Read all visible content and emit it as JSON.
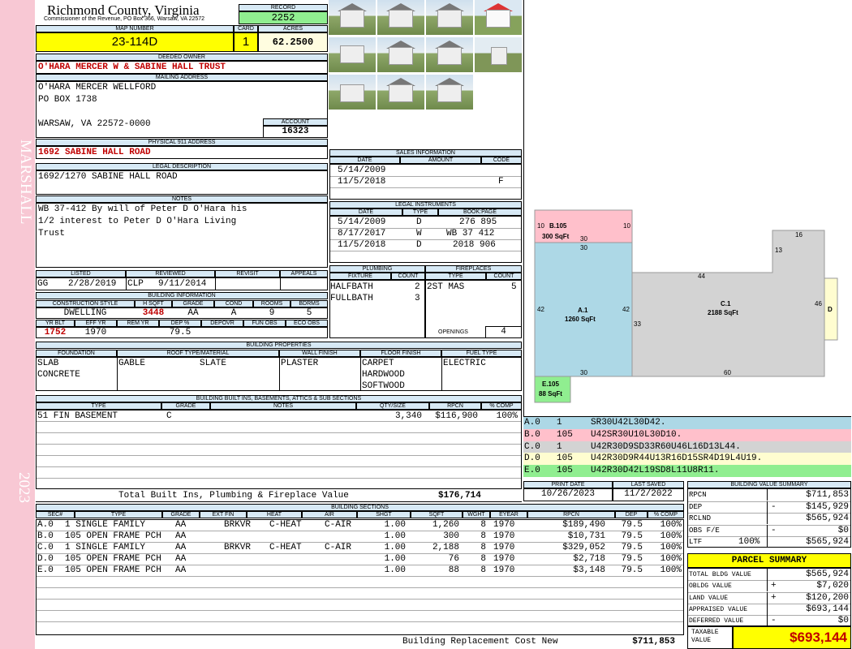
{
  "side_label": "MARSHALL",
  "side_year": "2023",
  "header": {
    "county": "Richmond County, Virginia",
    "subtitle": "Commissioner of the Revenue, PO Box 366, Warsaw, VA 22572",
    "record_label": "RECORD",
    "record": "2252"
  },
  "map_number_label": "MAP NUMBER",
  "map_number": "23-114D",
  "card_label": "CARD",
  "card": "1",
  "acres_label": "ACRES",
  "acres": "62.2500",
  "owner_label": "DEEDED OWNER",
  "owner": "O'HARA MERCER W & SABINE HALL TRUST",
  "mailing_label": "MAILING ADDRESS",
  "mailing": [
    "O'HARA MERCER WELLFORD",
    "PO BOX 1738",
    "",
    "WARSAW, VA 22572-0000"
  ],
  "account_label": "ACCOUNT",
  "account": "16323",
  "physical_label": "PHYSICAL 911 ADDRESS",
  "physical": "1692 SABINE HALL ROAD",
  "legal_label": "LEGAL DESCRIPTION",
  "legal": "1692/1270 SABINE HALL ROAD",
  "notes_label": "NOTES",
  "notes": [
    "WB 37-412 By will of Peter D O'Hara his",
    "1/2 interest to Peter D O'Hara Living",
    "Trust"
  ],
  "listed": {
    "labels": [
      "LISTED",
      "REVIEWED",
      "REVISIT",
      "APPEALS"
    ],
    "listed_by": "GG",
    "listed_date": "2/28/2019",
    "reviewed_by": "CLP",
    "reviewed_date": "9/11/2014"
  },
  "bldg_info": {
    "title": "BUILDING INFORMATION",
    "h1": [
      "CONSTRUCTION STYLE",
      "H SQFT",
      "GRADE",
      "COND",
      "ROOMS",
      "BDRMS"
    ],
    "v1": [
      "DWELLING",
      "3448",
      "AA",
      "A",
      "9",
      "5"
    ],
    "h2": [
      "YR BLT",
      "EFF YR",
      "REM YR",
      "DEP %",
      "DEPOVR",
      "FUN OBS",
      "ECO OBS"
    ],
    "v2": [
      "1752",
      "1970",
      "",
      "79.5",
      "",
      "",
      ""
    ]
  },
  "sales": {
    "title": "SALES INFORMATION",
    "cols": [
      "DATE",
      "AMOUNT",
      "CODE"
    ],
    "rows": [
      [
        "5/14/2009",
        "",
        ""
      ],
      [
        "11/5/2018",
        "",
        "F"
      ]
    ]
  },
  "legal_inst": {
    "title": "LEGAL INSTRUMENTS",
    "cols": [
      "DATE",
      "TYPE",
      "BOOK:PAGE"
    ],
    "rows": [
      [
        "5/14/2009",
        "D",
        "276 895"
      ],
      [
        "8/17/2017",
        "W",
        "WB 37 412"
      ],
      [
        "11/5/2018",
        "D",
        "2018 906"
      ]
    ]
  },
  "plumbing": {
    "title": "PLUMBING",
    "cols": [
      "FIXTURE",
      "COUNT"
    ],
    "rows": [
      [
        "HALFBATH",
        "2"
      ],
      [
        "FULLBATH",
        "3"
      ]
    ]
  },
  "fireplaces": {
    "title": "FIREPLACES",
    "cols": [
      "TYPE",
      "COUNT"
    ],
    "rows": [
      [
        "2ST MAS",
        "5"
      ]
    ],
    "openings_label": "OPENINGS",
    "openings": "4"
  },
  "props": {
    "title": "BUILDING PROPERTIES",
    "cols": [
      "FOUNDATION",
      "ROOF TYPE/MATERIAL",
      "WALL FINISH",
      "FLOOR FINISH",
      "FUEL TYPE"
    ],
    "foundation": [
      "SLAB",
      "CONCRETE"
    ],
    "roof_type": "GABLE",
    "roof_mat": "SLATE",
    "wall": "PLASTER",
    "floor": [
      "CARPET",
      "HARDWOOD",
      "SOFTWOOD"
    ],
    "fuel": "ELECTRIC"
  },
  "builtins": {
    "title": "BUILDING BUILT INS, BASEMENTS, ATTICS & SUB SECTIONS",
    "cols": [
      "TYPE",
      "GRADE",
      "NOTES",
      "QTY/SIZE",
      "RPCN",
      "% COMP"
    ],
    "row": [
      "51 FIN BASEMENT",
      "C",
      "",
      "3,340",
      "$116,900",
      "100%"
    ],
    "total_label": "Total Built Ins, Plumbing & Fireplace Value",
    "total": "$176,714"
  },
  "sketch": {
    "labels": {
      "a": "A.1",
      "a_sq": "1260 SqFt",
      "b": "B.105",
      "b_sq": "300 SqFt",
      "c": "C.1",
      "c_sq": "2188 SqFt",
      "d": "D",
      "e": "E.105",
      "e_sq": "88 SqFt"
    },
    "dims": [
      "10",
      "30",
      "10",
      "30",
      "42",
      "42",
      "30",
      "33",
      "44",
      "13",
      "16",
      "46",
      "60"
    ]
  },
  "vectors": [
    {
      "id": "A.0",
      "n": "1",
      "v": "SR30U42L30D42.",
      "color": "#add8e6"
    },
    {
      "id": "B.0",
      "n": "105",
      "v": "U42SR30U10L30D10.",
      "color": "#ffc0cb"
    },
    {
      "id": "C.0",
      "n": "1",
      "v": "U42R30D9SD33R60U46L16D13L44.",
      "color": "#d3d3d3"
    },
    {
      "id": "D.0",
      "n": "105",
      "v": "U42R30D9R44U13R16D15SR4D19L4U19.",
      "color": "#fffdd0"
    },
    {
      "id": "E.0",
      "n": "105",
      "v": "U42R30D42L19SD8L11U8R11.",
      "color": "#90ee90"
    }
  ],
  "print": {
    "print_label": "PRINT DATE",
    "print_date": "10/26/2023",
    "saved_label": "LAST SAVED",
    "saved_date": "11/2/2022"
  },
  "bvs": {
    "title": "BUILDING VALUE SUMMARY",
    "rows": [
      [
        "RPCN",
        "",
        "",
        "$711,853"
      ],
      [
        "DEP",
        "",
        "-",
        "$145,929"
      ],
      [
        "RCLND",
        "",
        "",
        "$565,924"
      ],
      [
        "OBS F/E",
        "",
        "-",
        "$0"
      ],
      [
        "LTF",
        "100%",
        "",
        "$565,924"
      ]
    ]
  },
  "parcel": {
    "title": "PARCEL SUMMARY",
    "rows": [
      [
        "TOTAL BLDG VALUE",
        "",
        "$565,924"
      ],
      [
        "OBLDG VALUE",
        "+",
        "$7,020"
      ],
      [
        "LAND VALUE",
        "+",
        "$120,200"
      ],
      [
        "APPRAISED VALUE",
        "",
        "$693,144"
      ],
      [
        "DEFERRED VALUE",
        "-",
        "$0"
      ]
    ],
    "taxable_label": "TAXABLE VALUE",
    "taxable": "$693,144"
  },
  "sections": {
    "title": "BUILDING SECTIONS",
    "cols": [
      "SEC#",
      "TYPE",
      "GRADE",
      "EXT FIN",
      "HEAT",
      "AIR",
      "SHGT",
      "SQFT",
      "WGHT",
      "EYEAR",
      "RPCN",
      "DEP",
      "% COMP"
    ],
    "rows": [
      [
        "A.0",
        "1 SINGLE FAMILY",
        "AA",
        "BRKVR",
        "C-HEAT",
        "C-AIR",
        "1.00",
        "1,260",
        "8",
        "1970",
        "$189,490",
        "79.5",
        "100%"
      ],
      [
        "B.0",
        "105 OPEN FRAME PCH",
        "AA",
        "",
        "",
        "",
        "1.00",
        "300",
        "8",
        "1970",
        "$10,731",
        "79.5",
        "100%"
      ],
      [
        "C.0",
        "1 SINGLE FAMILY",
        "AA",
        "BRKVR",
        "C-HEAT",
        "C-AIR",
        "1.00",
        "2,188",
        "8",
        "1970",
        "$329,052",
        "79.5",
        "100%"
      ],
      [
        "D.0",
        "105 OPEN FRAME PCH",
        "AA",
        "",
        "",
        "",
        "1.00",
        "76",
        "8",
        "1970",
        "$2,718",
        "79.5",
        "100%"
      ],
      [
        "E.0",
        "105 OPEN FRAME PCH",
        "AA",
        "",
        "",
        "",
        "1.00",
        "88",
        "8",
        "1970",
        "$3,148",
        "79.5",
        "100%"
      ]
    ],
    "rcn_label": "Building Replacement Cost New",
    "rcn": "$711,853"
  }
}
